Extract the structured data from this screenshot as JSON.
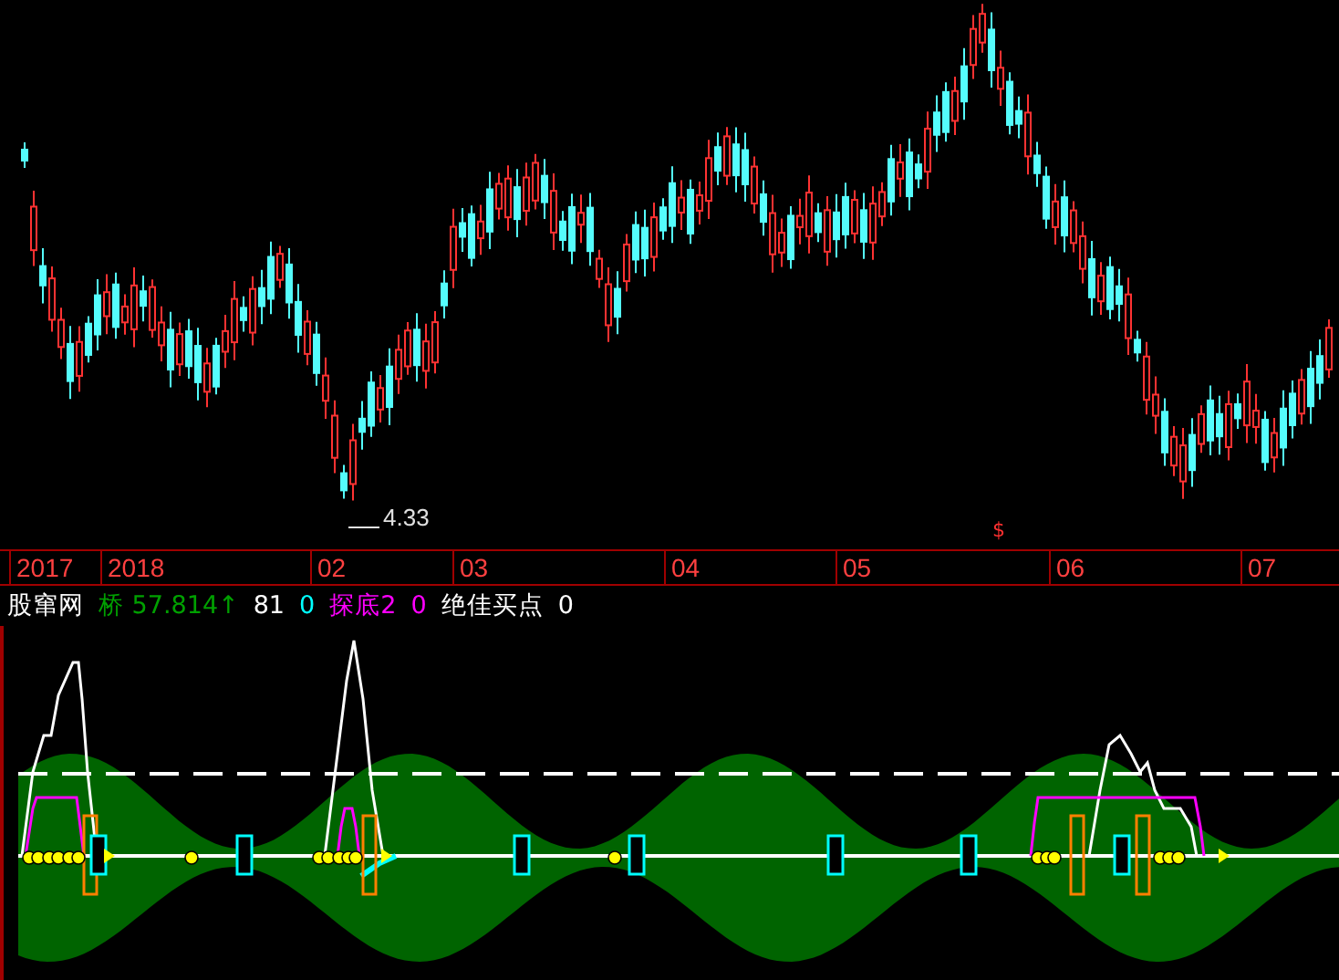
{
  "price_chart": {
    "low_label": "4.33",
    "marker": "$"
  },
  "time_axis": {
    "labels": [
      "2017",
      "2018",
      "02",
      "03",
      "04",
      "05",
      "06",
      "07"
    ]
  },
  "indicator": {
    "legend": [
      {
        "text": "股窜网",
        "color": "#ffffff"
      },
      {
        "text": "桥 57.814↑",
        "color": "#00a000"
      },
      {
        "text": "81",
        "color": "#ffffff"
      },
      {
        "text": "0",
        "color": "#00ffff"
      },
      {
        "text": "探底2",
        "color": "#ff00ff"
      },
      {
        "text": "0",
        "color": "#ff00ff"
      },
      {
        "text": "绝佳买点",
        "color": "#ffffff"
      },
      {
        "text": "0",
        "color": "#ffffff"
      }
    ]
  }
}
